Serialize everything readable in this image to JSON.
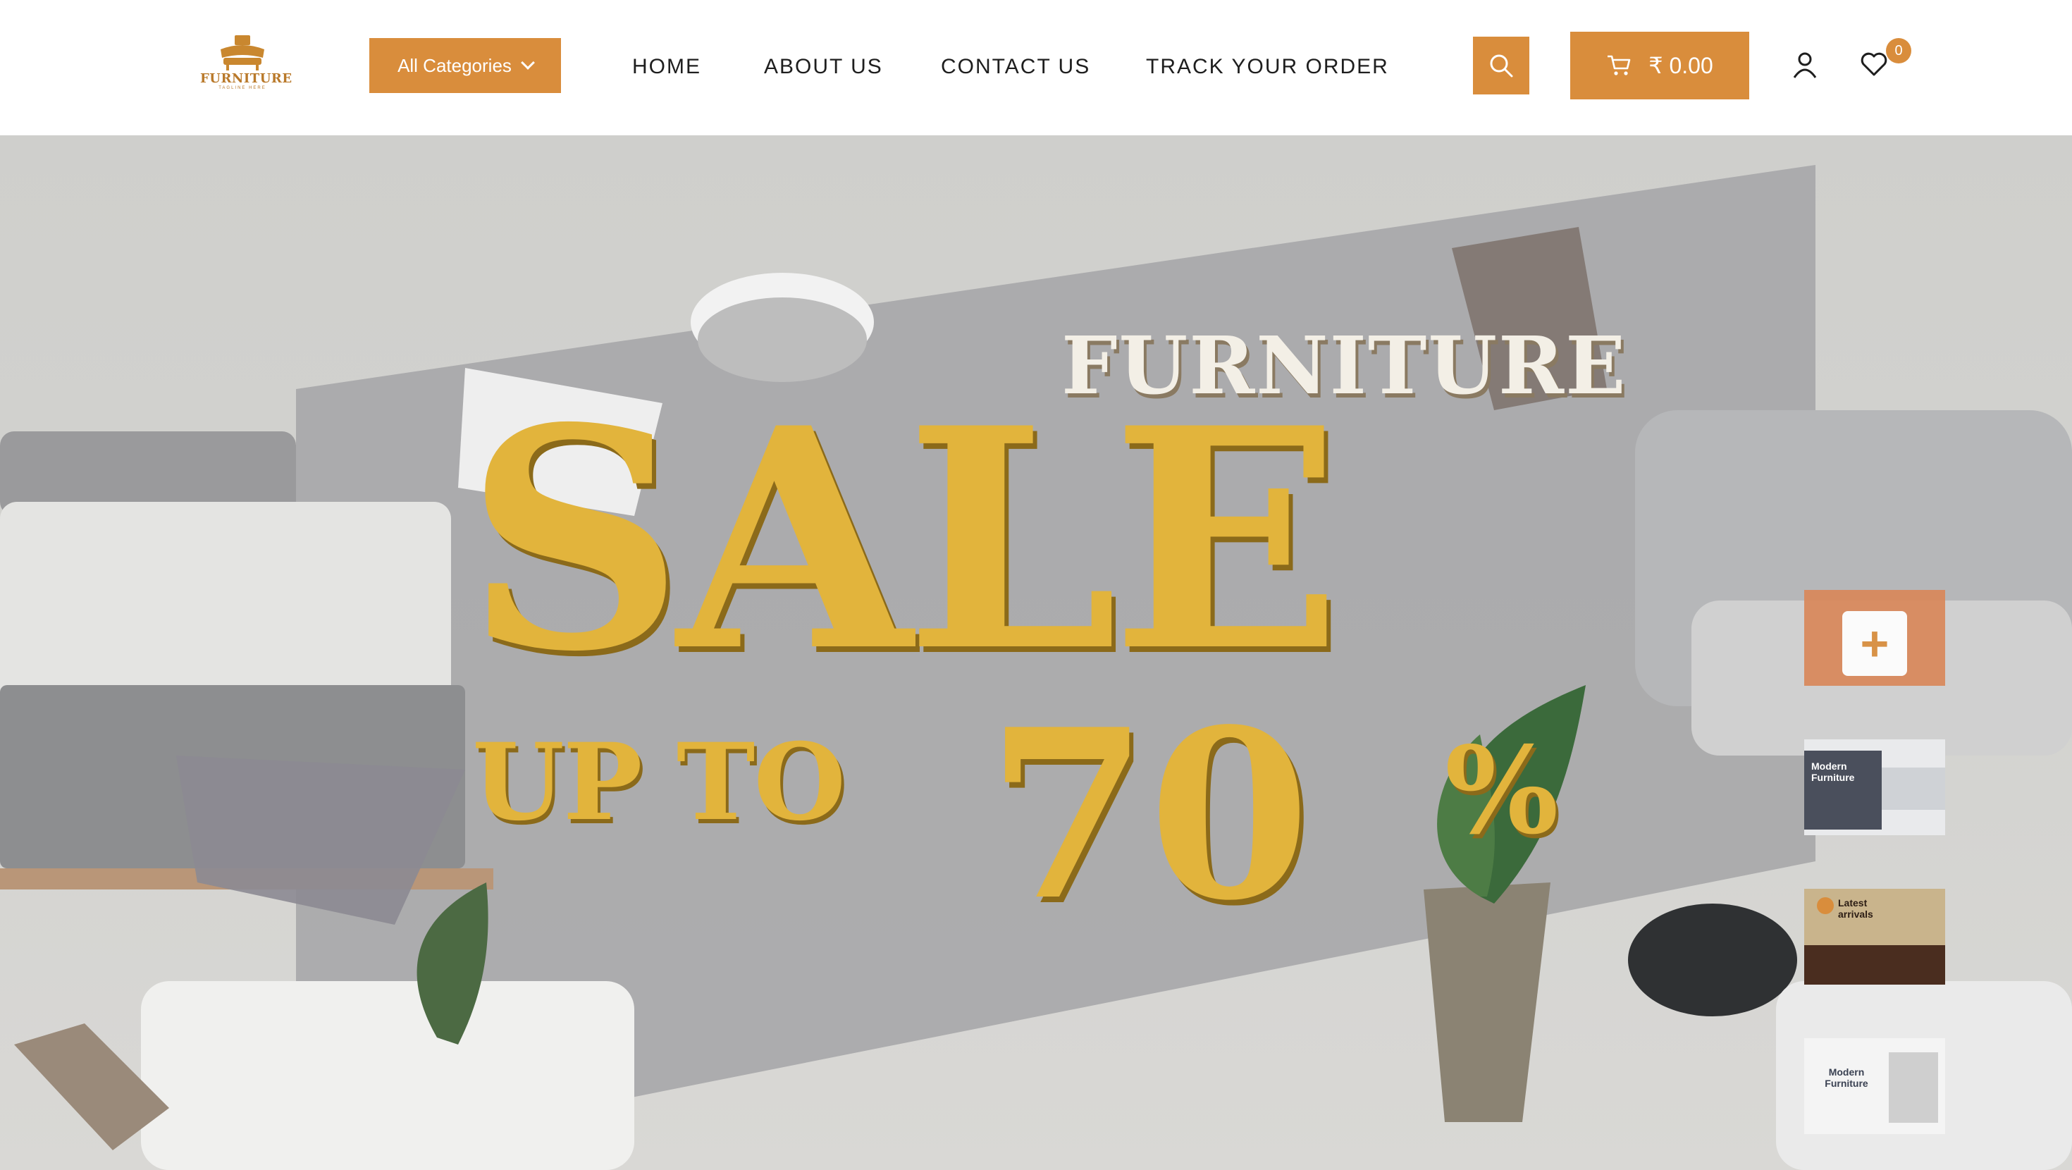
{
  "brand": {
    "name": "FURNITURE",
    "tagline": "TAGLINE HERE"
  },
  "header": {
    "categories_label": "All Categories",
    "nav": [
      "HOME",
      "ABOUT US",
      "CONTACT US",
      "TRACK YOUR ORDER"
    ],
    "cart_total": "₹ 0.00",
    "wishlist_count": "0"
  },
  "hero": {
    "line1": "FURNITURE",
    "line2": "SALE",
    "line3": "UP TO",
    "line4": "70",
    "line5": "%"
  },
  "thumbnails": [
    {
      "kind": "add",
      "symbol": "+"
    },
    {
      "title": "Modern Furniture"
    },
    {
      "title": "Latest arrivals"
    },
    {
      "title": "Modern Furniture"
    }
  ],
  "colors": {
    "accent": "#d98d3c",
    "sale": "#e2b43c",
    "panel": "#a4a5a7"
  },
  "icons": [
    "chevron-down-icon",
    "search-icon",
    "cart-icon",
    "user-icon",
    "heart-icon",
    "plus-icon"
  ]
}
